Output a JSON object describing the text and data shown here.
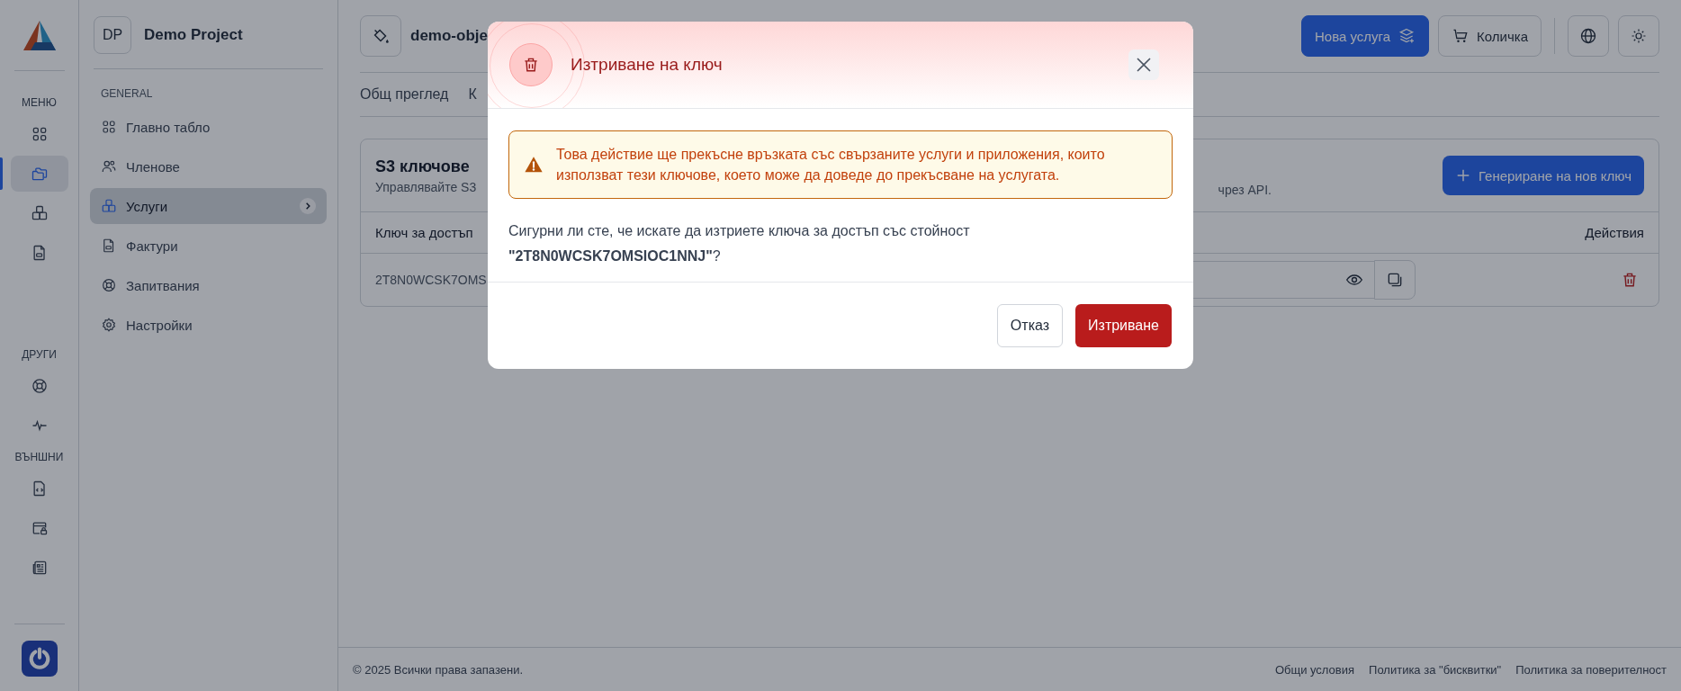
{
  "rail": {
    "sections": [
      {
        "label": "МЕНЮ",
        "items": [
          {
            "selected": false
          },
          {
            "selected": true
          },
          {
            "selected": false
          },
          {
            "selected": false
          }
        ]
      },
      {
        "label": "ДРУГИ",
        "items": [
          {
            "selected": false
          },
          {
            "selected": false
          }
        ]
      },
      {
        "label": "ВЪНШНИ",
        "items": [
          {
            "selected": false
          },
          {
            "selected": false
          },
          {
            "selected": false
          }
        ]
      }
    ]
  },
  "project": {
    "initials": "DP",
    "name": "Demo Project"
  },
  "nav": {
    "heading": "GENERAL",
    "items": [
      {
        "label": "Главно табло",
        "selected": false
      },
      {
        "label": "Членове",
        "selected": false
      },
      {
        "label": "Услуги",
        "selected": true
      },
      {
        "label": "Фактури",
        "selected": false
      },
      {
        "label": "Запитвания",
        "selected": false
      },
      {
        "label": "Настройки",
        "selected": false
      }
    ]
  },
  "topbar": {
    "bucket_name": "demo-obje",
    "buttons": [
      {
        "label": "Нова услуга",
        "kind": "primary"
      },
      {
        "label": "Количка",
        "kind": "cart"
      }
    ]
  },
  "tabs": [
    {
      "label": "Общ преглед"
    },
    {
      "label": "К"
    }
  ],
  "card": {
    "title": "S3 ключове",
    "subtitle_start": "Управлявайте S3",
    "subtitle_end": "чрез API.",
    "generate_button": "Генериране на нов ключ",
    "columns": [
      "Ключ за достъп",
      "Действия"
    ],
    "rows": [
      {
        "key": "2T8N0WCSK7OMS"
      }
    ]
  },
  "footer": {
    "copyright": "© 2025 Всички права запазени.",
    "links": [
      "Общи условия",
      "Политика за \"бисквитки\"",
      "Политика за поверителност"
    ]
  },
  "dialog": {
    "title": "Изтриване на ключ",
    "warning": "Това действие ще прекъсне връзката със свързаните услуги и приложения, които използват тези ключове, което може да доведе до прекъсване на услугата.",
    "message": "Сигурни ли сте, че искате да изтриете ключа за достъп със стойност **\"2T8N0WCSK7OMSIOC1NNJ\"**?",
    "cancel": "Отказ",
    "confirm": "Изтриване"
  }
}
